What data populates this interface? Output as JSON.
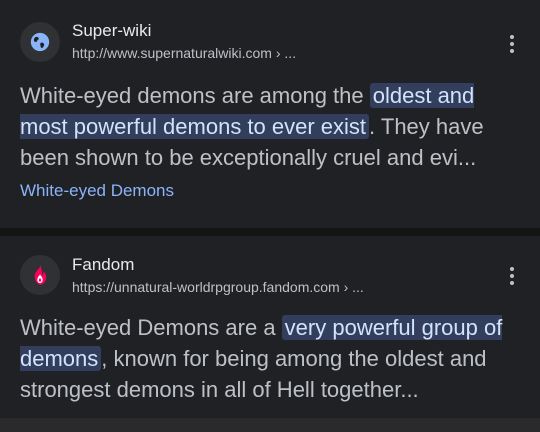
{
  "results": [
    {
      "site_name": "Super-wiki",
      "url": "http://www.supernaturalwiki.com",
      "url_suffix": " › ...",
      "snippet_before": "White-eyed demons are among the ",
      "snippet_highlight": "oldest and most powerful demons to ever exist",
      "snippet_after": ". They have been shown to be exceptionally cruel and evi...",
      "sublink": "White-eyed Demons",
      "favicon": "globe-icon"
    },
    {
      "site_name": "Fandom",
      "url": "https://unnatural-worldrpgroup.fandom.com",
      "url_suffix": " › ...",
      "snippet_before": "White-eyed Demons are a ",
      "snippet_highlight": "very powerful group of demons",
      "snippet_after": ", known for being among the oldest and strongest demons in all of Hell together...",
      "favicon": "fandom-flame-icon"
    }
  ],
  "colors": {
    "highlight_bg": "#323e5b",
    "link": "#8ab4f8",
    "fandom_brand": "#fa005a"
  }
}
